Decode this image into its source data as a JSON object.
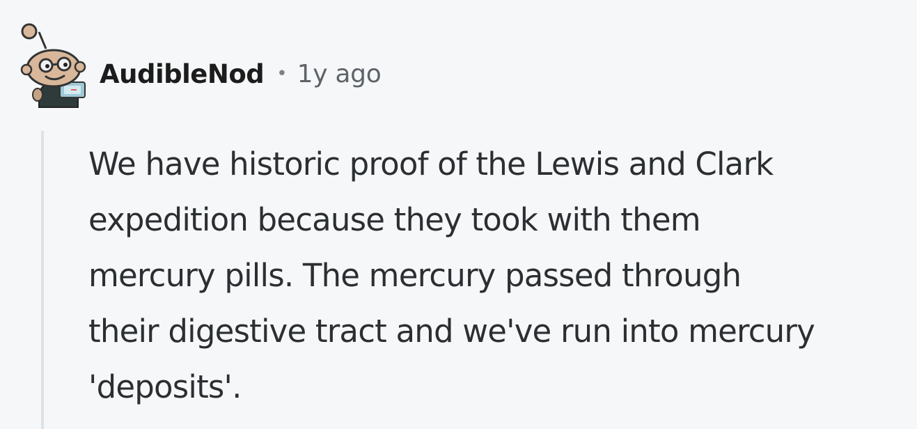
{
  "comment": {
    "author": "AudibleNod",
    "separator": "•",
    "timestamp": "1y ago",
    "avatar_icon": "reddit-snoo-avatar-icon",
    "body_lines": [
      "We have historic proof of the Lewis and Clark",
      "expedition because they took with them",
      "mercury pills. The mercury passed through",
      "their digestive tract and we've run into mercury",
      "'deposits'."
    ]
  },
  "colors": {
    "background": "#f6f7f9",
    "username": "#1c1c1c",
    "timestamp": "#5d6368",
    "body": "#2b2f32",
    "thread_line": "#dde2e6"
  }
}
